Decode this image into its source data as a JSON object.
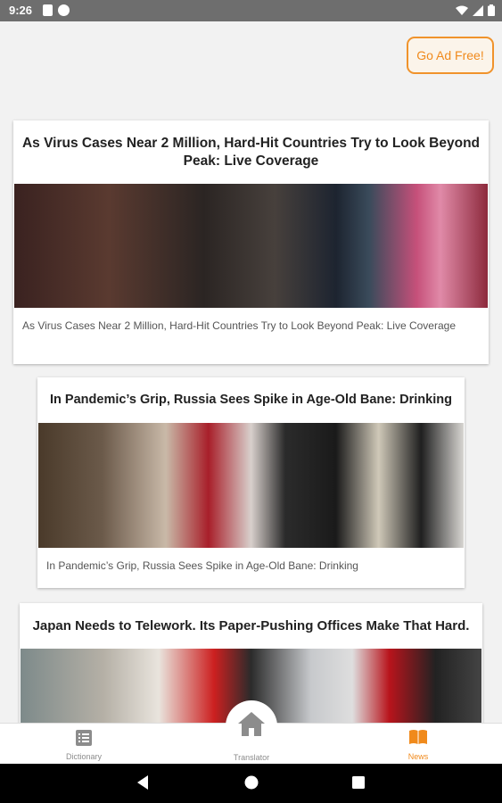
{
  "status_bar": {
    "time": "9:26",
    "icons_left": [
      "sd-card-icon",
      "app-notification-icon"
    ],
    "icons_right": [
      "wifi-icon",
      "signal-icon",
      "battery-icon"
    ]
  },
  "ad_free_button": {
    "label": "Go Ad Free!",
    "accent": "#f08a1c"
  },
  "articles": [
    {
      "headline": "As Virus Cases Near 2 Million, Hard-Hit Countries Try to Look Beyond Peak: Live Coverage",
      "caption": "As Virus Cases Near 2 Million, Hard-Hit Countries Try to Look Beyond Peak: Live Coverage"
    },
    {
      "headline": "In Pandemic’s Grip, Russia Sees Spike in Age-Old Bane: Drinking",
      "caption": "In Pandemic’s Grip, Russia Sees Spike in Age-Old Bane: Drinking"
    },
    {
      "headline": "Japan Needs to Telework. Its Paper-Pushing Offices Make That Hard.",
      "caption": ""
    }
  ],
  "bottom_nav": {
    "items": [
      {
        "label": "Dictionary",
        "icon": "list-icon",
        "active": false
      },
      {
        "label": "Translator",
        "icon": "home-icon",
        "active": false
      },
      {
        "label": "News",
        "icon": "book-icon",
        "active": true
      }
    ],
    "active_color": "#f08a1c",
    "inactive_color": "#8c8c8c"
  },
  "system_nav": {
    "buttons": [
      "back-icon",
      "home-button-icon",
      "recents-icon"
    ]
  }
}
